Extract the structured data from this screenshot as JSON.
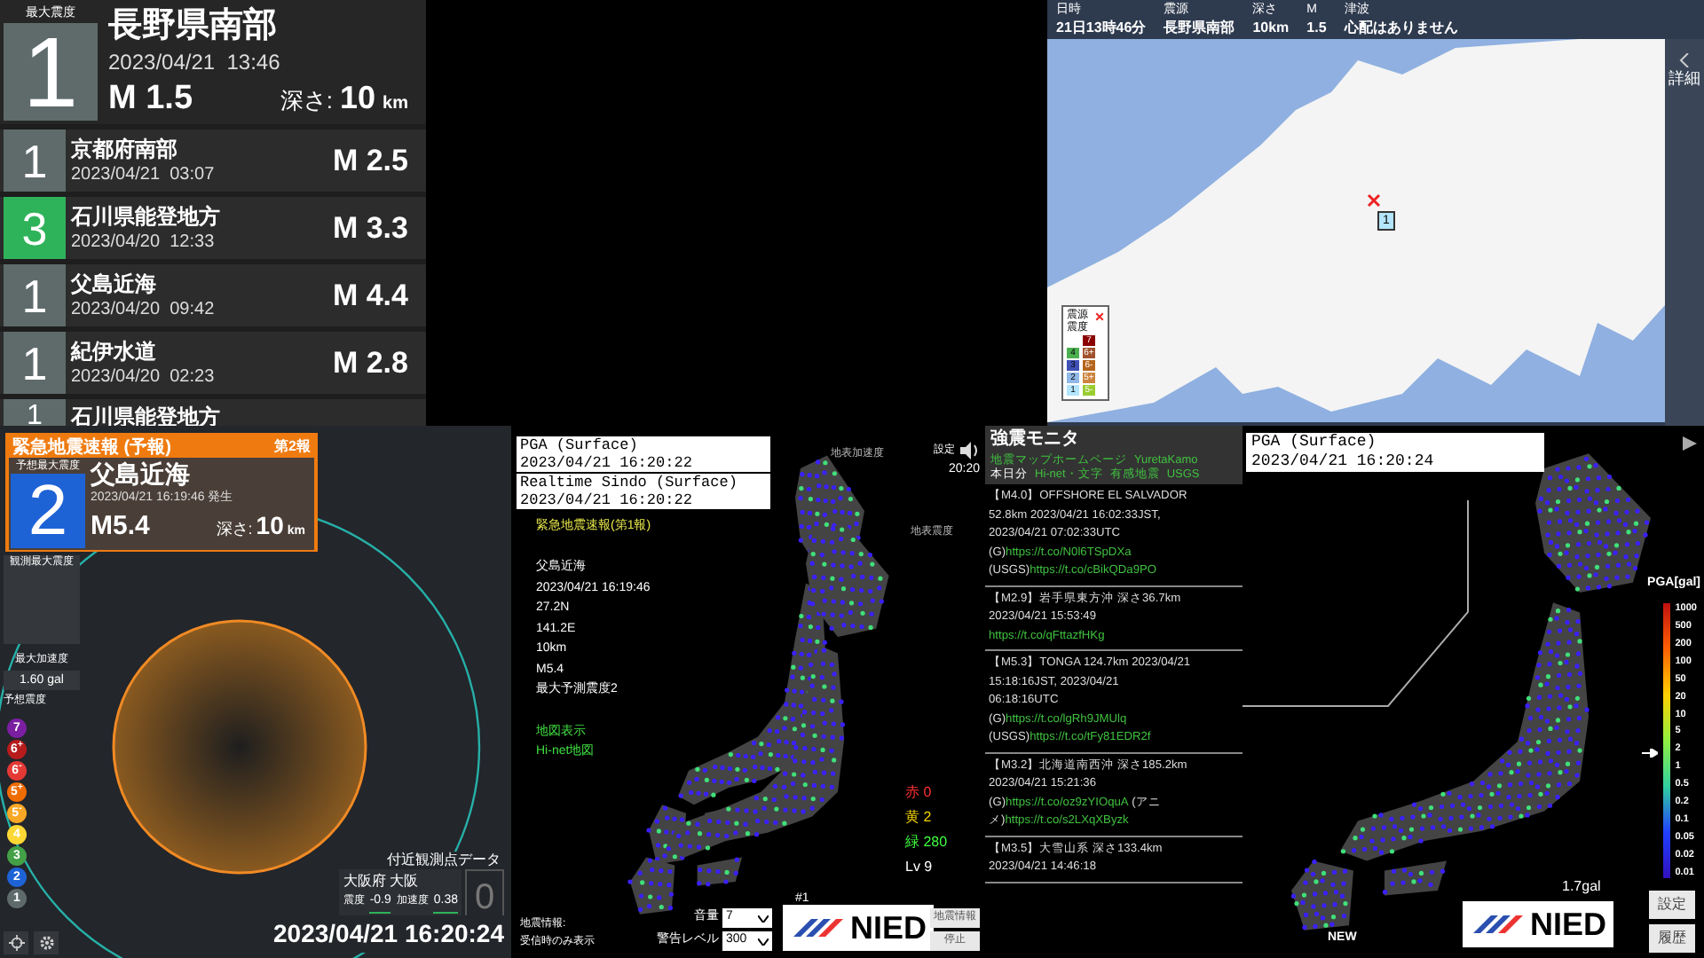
{
  "latest": {
    "label": "最大震度",
    "intensity": "1",
    "region": "長野県南部",
    "time": "2023/04/21  13:46",
    "magnitude": "M 1.5",
    "depth_label": "深さ:",
    "depth": "10",
    "depth_unit": "km"
  },
  "history": [
    {
      "intensity": "1",
      "color": "#5f6b6b",
      "region": "京都府南部",
      "time": "2023/04/21  03:07",
      "magnitude": "M 2.5"
    },
    {
      "intensity": "3",
      "color": "#2fb35a",
      "region": "石川県能登地方",
      "time": "2023/04/20  12:33",
      "magnitude": "M 3.3"
    },
    {
      "intensity": "1",
      "color": "#5f6b6b",
      "region": "父島近海",
      "time": "2023/04/20  09:42",
      "magnitude": "M 4.4"
    },
    {
      "intensity": "1",
      "color": "#5f6b6b",
      "region": "紀伊水道",
      "time": "2023/04/20  02:23",
      "magnitude": "M 2.8"
    },
    {
      "intensity": "1",
      "color": "#5f6b6b",
      "region": "石川県能登地方"
    }
  ],
  "quake_map": {
    "columns": [
      {
        "label": "日時",
        "value": "21日13時46分"
      },
      {
        "label": "震源",
        "value": "長野県南部"
      },
      {
        "label": "深さ",
        "value": "10km"
      },
      {
        "label": "M",
        "value": "1.5"
      },
      {
        "label": "津波",
        "value": "心配はありません"
      }
    ],
    "detail_button": "詳細",
    "marker": "1",
    "legend": {
      "epicenter_label": "震源",
      "intensity_label": "震度",
      "left": [
        {
          "label": "4",
          "color": "#4caf50"
        },
        {
          "label": "3",
          "color": "#3f51b5"
        },
        {
          "label": "2",
          "color": "#90b8e8"
        },
        {
          "label": "1",
          "color": "#b3e5fc"
        }
      ],
      "right": [
        {
          "label": "7",
          "color": "#8b0000"
        },
        {
          "label": "6+",
          "color": "#a0522d"
        },
        {
          "label": "6-",
          "color": "#b5651d"
        },
        {
          "label": "5+",
          "color": "#cd853f"
        },
        {
          "label": "5-",
          "color": "#9acd32"
        }
      ]
    }
  },
  "eew": {
    "title": "緊急地震速報 (予報)",
    "report": "第2報",
    "forecast_label": "予想最大震度",
    "intensity": "2",
    "region": "父島近海",
    "time": "2023/04/21 16:19:46 発生",
    "magnitude": "M5.4",
    "depth_label": "深さ:",
    "depth": "10",
    "depth_unit": "km",
    "observed_label": "観測最大震度",
    "max_accel_label": "最大加速度",
    "max_accel": "1.60 gal",
    "scale_label": "予想震度",
    "scale": [
      {
        "label": "7",
        "color": "#7b1fa2"
      },
      {
        "label": "6$^{+}$",
        "color": "#b71c1c"
      },
      {
        "label": "6$^{-}$",
        "color": "#e53935"
      },
      {
        "label": "5$^{+}$",
        "color": "#ef6c00"
      },
      {
        "label": "5$^{-}$",
        "color": "#f9a825"
      },
      {
        "label": "4",
        "color": "#fdd835"
      },
      {
        "label": "3",
        "color": "#43a047"
      },
      {
        "label": "2",
        "color": "#1e63d6"
      },
      {
        "label": "1",
        "color": "#5f6b6b"
      }
    ],
    "nearby": {
      "title": "付近観測点データ",
      "station": "大阪府 大阪",
      "intensity_label": "震度",
      "intensity": "-0.9",
      "accel_label": "加速度",
      "accel": "0.38",
      "value": "0"
    },
    "clock": "2023/04/21 16:20:24"
  },
  "kmoni": {
    "pga_box": {
      "title": "PGA (Surface)",
      "time": "2023/04/21 16:20:22"
    },
    "sindo_box": {
      "title": "Realtime Sindo (Surface)",
      "time": "2023/04/21 16:20:22"
    },
    "settings_label": "設定",
    "clock": "20:20",
    "map_labels": [
      "地表加速度",
      "地表震度"
    ],
    "eew_title": "緊急地震速報(第1報)",
    "eew_lines": [
      "父島近海",
      "2023/04/21 16:19:46",
      "27.2N",
      "141.2E",
      "10km",
      "M5.4",
      "最大予測震度2"
    ],
    "links": [
      "地図表示",
      "Hi-net地図"
    ],
    "counts": [
      {
        "label": "赤 0",
        "color": "#ff3030"
      },
      {
        "label": "黄 2",
        "color": "#f0d000"
      },
      {
        "label": "緑 280",
        "color": "#40ff40"
      },
      {
        "label": "Lv 9",
        "color": "#ffffff"
      }
    ],
    "volume_label": "音量",
    "volume": "7",
    "alert_label": "警告レベル",
    "alert": "300",
    "channel": "#1",
    "info_label": "地震情報:",
    "info_note": "受信時のみ表示",
    "buttons": [
      "地震情報",
      "停止"
    ],
    "logo": "NIED"
  },
  "feed": {
    "title": "強震モニタ",
    "nav": [
      [
        {
          "kind": "link",
          "text": "地震マップホームページ"
        },
        {
          "kind": "link",
          "text": "YuretaKamo"
        }
      ],
      [
        {
          "kind": "text",
          "text": "本日分"
        },
        {
          "kind": "link",
          "text": "Hi-net・文字"
        },
        {
          "kind": "link",
          "text": "有感地震"
        },
        {
          "kind": "link",
          "text": "USGS"
        }
      ]
    ],
    "posts": [
      [
        [
          {
            "kind": "text",
            "text": "【M4.0】OFFSHORE EL SALVADOR"
          }
        ],
        [
          {
            "kind": "text",
            "text": "52.8km 2023/04/21 16:02:33JST,"
          }
        ],
        [
          {
            "kind": "text",
            "text": "2023/04/21 07:02:33UTC"
          }
        ],
        [
          {
            "kind": "text",
            "text": "(G)"
          },
          {
            "kind": "link",
            "text": "https://t.co/N0l6TSpDXa"
          }
        ],
        [
          {
            "kind": "text",
            "text": "(USGS)"
          },
          {
            "kind": "link",
            "text": "https://t.co/cBikQDa9PO"
          }
        ]
      ],
      [
        [
          {
            "kind": "text",
            "text": "【M2.9】岩手県東方沖 深さ36.7km"
          }
        ],
        [
          {
            "kind": "text",
            "text": "2023/04/21 15:53:49"
          }
        ],
        [
          {
            "kind": "link",
            "text": "https://t.co/qFttazfHKg"
          }
        ]
      ],
      [
        [
          {
            "kind": "text",
            "text": "【M5.3】TONGA 124.7km 2023/04/21"
          }
        ],
        [
          {
            "kind": "text",
            "text": "15:18:16JST, 2023/04/21"
          }
        ],
        [
          {
            "kind": "text",
            "text": "06:18:16UTC"
          }
        ],
        [
          {
            "kind": "text",
            "text": "(G)"
          },
          {
            "kind": "link",
            "text": "https://t.co/lgRh9JMUlq"
          }
        ],
        [
          {
            "kind": "text",
            "text": "(USGS)"
          },
          {
            "kind": "link",
            "text": "https://t.co/tFy81EDR2f"
          }
        ]
      ],
      [
        [
          {
            "kind": "text",
            "text": "【M3.2】北海道南西沖 深さ185.2km"
          }
        ],
        [
          {
            "kind": "text",
            "text": "2023/04/21 15:21:36"
          }
        ],
        [
          {
            "kind": "text",
            "text": "(G)"
          },
          {
            "kind": "link",
            "text": "https://t.co/oz9zYIOquA"
          },
          {
            "kind": "text",
            "text": " (アニ"
          }
        ],
        [
          {
            "kind": "text",
            "text": "メ)"
          },
          {
            "kind": "link",
            "text": "https://t.co/s2LXqXByzk"
          }
        ]
      ],
      [
        [
          {
            "kind": "text",
            "text": "【M3.5】大雪山系 深さ133.4km"
          }
        ],
        [
          {
            "kind": "text",
            "text": "2023/04/21 14:46:18"
          }
        ]
      ]
    ]
  },
  "pga": {
    "title": "PGA (Surface)",
    "time": "2023/04/21 16:20:24",
    "scale_title": "PGA[gal]",
    "scale": [
      "1000",
      "500",
      "200",
      "100",
      "50",
      "20",
      "10",
      "5",
      "2",
      "1",
      "0.5",
      "0.2",
      "0.1",
      "0.05",
      "0.02",
      "0.01"
    ],
    "level": 0.45,
    "reading": "1.7gal",
    "new_label": "NEW",
    "buttons": [
      "設定",
      "履歴"
    ],
    "logo": "NIED"
  }
}
